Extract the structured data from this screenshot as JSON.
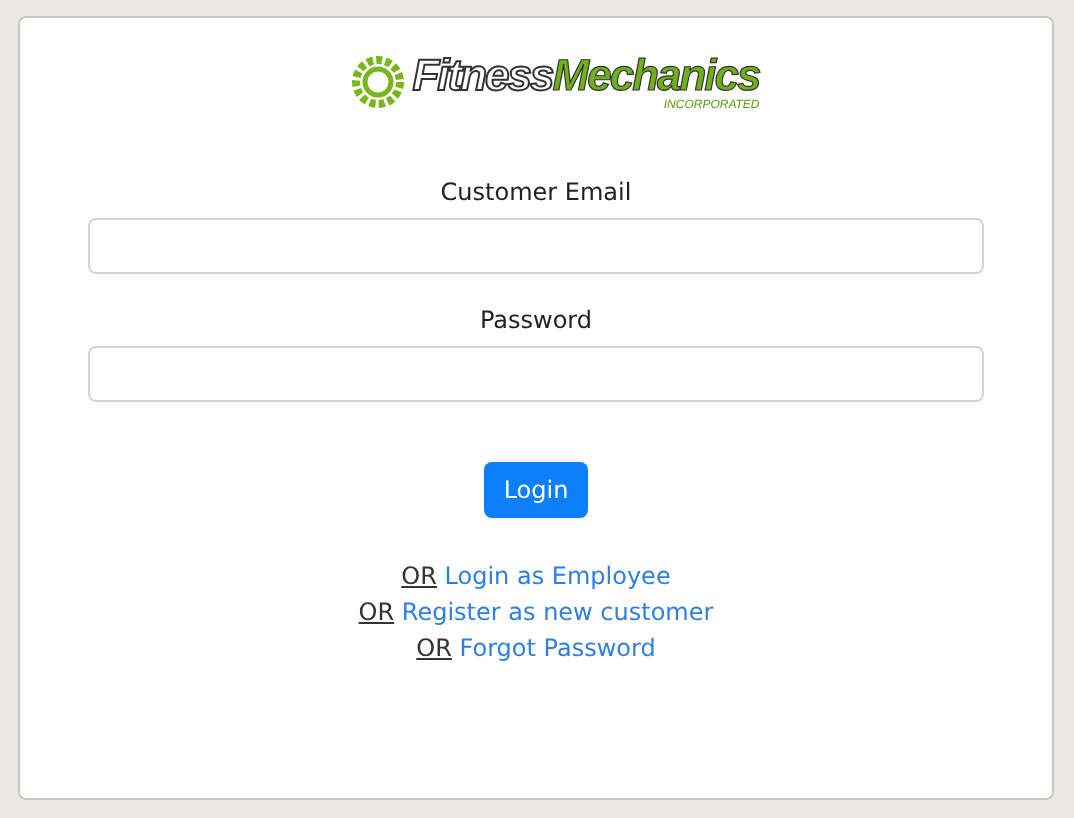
{
  "logo": {
    "word_1": "Fitness",
    "word_2": "Mechanics",
    "tagline": "INCORPORATED"
  },
  "fields": [
    {
      "label": "Customer Email"
    },
    {
      "label": "Password"
    }
  ],
  "login_button": "Login",
  "links": [
    {
      "prefix": "OR",
      "text": "Login as Employee"
    },
    {
      "prefix": "OR",
      "text": "Register as new customer"
    },
    {
      "prefix": "OR",
      "text": "Forgot Password"
    }
  ]
}
